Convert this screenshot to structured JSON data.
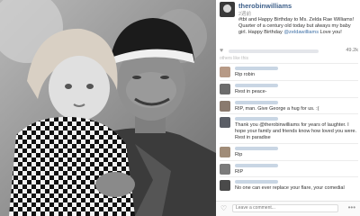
{
  "post": {
    "username": "therobinwilliams",
    "age": "2週前",
    "caption": "#tbt and Happy Birthday to Ms. Zelda Rae Williams! Quarter of a century old today but always my baby girl. Happy Birthday",
    "mention": "@zeldawilliams",
    "caption_end": " Love you!",
    "likes_count": "49.2k",
    "others_text": "others like this"
  },
  "comments": [
    {
      "text": "Rip robin",
      "avatar_color": "#b79a86"
    },
    {
      "text": "Rest in peace-",
      "avatar_color": "#6c6c6c"
    },
    {
      "text": "RIP, man. Give George a hug for us. :(",
      "avatar_color": "#8a7a6e"
    },
    {
      "text": "Thank you @therobinwilliams for years of laughter. I hope your family and friends know how loved you were. Rest in paradise",
      "avatar_color": "#5a5e66"
    },
    {
      "text": "Rip",
      "avatar_color": "#a08c78"
    },
    {
      "text": "RIP",
      "avatar_color": "#7a7a7a"
    },
    {
      "text": "No one can ever replace your flare, your comedial",
      "avatar_color": "#4a4a4a"
    }
  ],
  "footer": {
    "comment_placeholder": "Leave a comment...",
    "more_label": "•••"
  },
  "icons": {
    "like": "heart-icon",
    "more": "more-icon"
  }
}
